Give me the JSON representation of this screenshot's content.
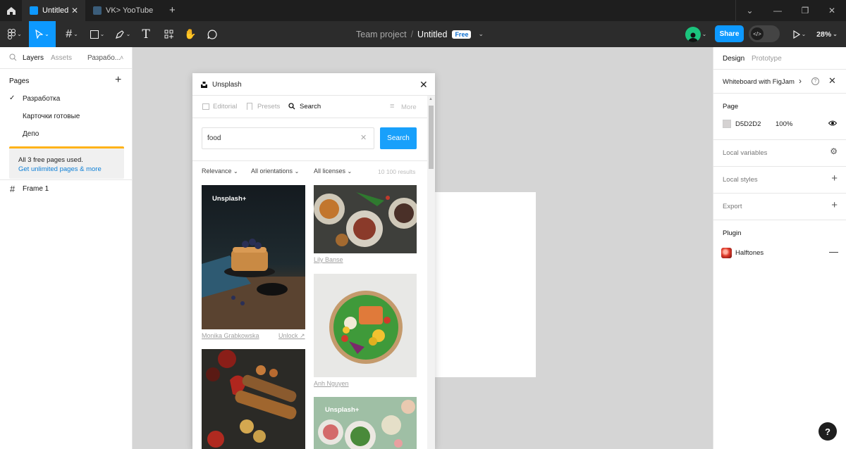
{
  "tabbar": {
    "tabs": [
      {
        "label": "Untitled",
        "active": true
      },
      {
        "label": "VK> YooTube",
        "active": false
      }
    ]
  },
  "toolbar": {
    "project": "Team project",
    "separator": "/",
    "file": "Untitled",
    "badge": "Free",
    "share_label": "Share",
    "zoom": "28%"
  },
  "left_panel": {
    "tabs": [
      "Layers",
      "Assets",
      "Разрабо..."
    ],
    "pages_title": "Pages",
    "pages": [
      "Разработка",
      "Карточки готовые",
      "Депо"
    ],
    "notice_text": "All 3 free pages used.",
    "notice_link": "Get unlimited pages & more",
    "layer": "Frame 1"
  },
  "right_panel": {
    "tabs": [
      "Design",
      "Prototype"
    ],
    "whiteboard": "Whiteboard with FigJam",
    "page_label": "Page",
    "page_color": "D5D2D2",
    "page_opacity": "100%",
    "local_variables": "Local variables",
    "local_styles": "Local styles",
    "export": "Export",
    "plugin_label": "Plugin",
    "plugin_name": "Halftones"
  },
  "plugin": {
    "title": "Unsplash",
    "tabs": [
      "Editorial",
      "Presets",
      "Search"
    ],
    "more": "More",
    "search_value": "food",
    "search_button": "Search",
    "filters": [
      "Relevance",
      "All orientations",
      "All licenses"
    ],
    "results": "10 100 results",
    "badge": "Unsplash+",
    "captions": {
      "img1": "Monika Grabkowska",
      "unlock": "Unlock ↗",
      "img2": "Lily Banse",
      "img3": "Anh Nguyen"
    }
  },
  "colors": {
    "accent": "#0d99ff",
    "canvas": "#D5D2D2",
    "notice": "#ffb31a"
  },
  "help": "?"
}
